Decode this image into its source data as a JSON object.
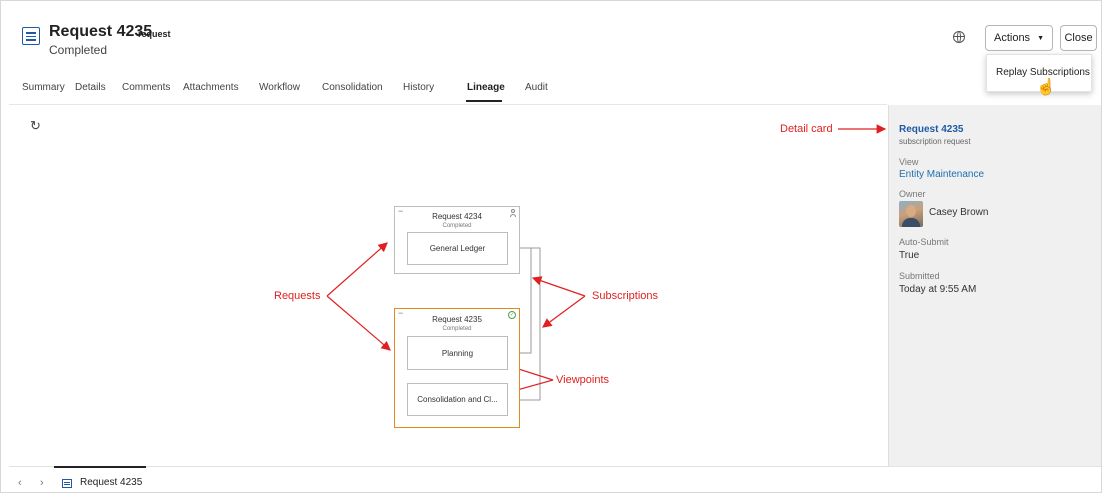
{
  "header": {
    "title": "Request 4235",
    "title_tag": "request",
    "status": "Completed",
    "icon": "request-list-icon",
    "globe_icon": "globe-icon"
  },
  "toolbar": {
    "actions_label": "Actions",
    "close_label": "Close"
  },
  "actions_menu": {
    "items": [
      "Replay Subscriptions"
    ]
  },
  "tabs": [
    "Summary",
    "Details",
    "Comments",
    "Attachments",
    "Workflow",
    "Consolidation",
    "History",
    "Lineage",
    "Audit"
  ],
  "active_tab": "Lineage",
  "diagram": {
    "refresh_icon": "refresh-icon",
    "nodes": [
      {
        "title": "Request 4234",
        "status": "Completed",
        "badge_icon": "user-icon",
        "viewpoints": [
          "General Ledger"
        ]
      },
      {
        "title": "Request 4235",
        "status": "Completed",
        "badge_icon": "check-circle-icon",
        "selected": true,
        "viewpoints": [
          "Planning",
          "Consolidation and Cl..."
        ]
      }
    ],
    "annotations": {
      "detail_card": "Detail card",
      "requests": "Requests",
      "subscriptions": "Subscriptions",
      "viewpoints": "Viewpoints"
    },
    "annotation_color": "#e02020",
    "selected_color": "#e08a1e"
  },
  "detail_card": {
    "title": "Request 4235",
    "subtitle": "subscription request",
    "view_label": "View",
    "view_value": "Entity Maintenance",
    "owner_label": "Owner",
    "owner_name": "Casey Brown",
    "auto_submit_label": "Auto-Submit",
    "auto_submit_value": "True",
    "submitted_label": "Submitted",
    "submitted_value": "Today at 9:55 AM"
  },
  "footer": {
    "prev_icon": "chevron-left-icon",
    "next_icon": "chevron-right-icon",
    "tab_label": "Request 4235"
  },
  "colors": {
    "brand_blue": "#1f5aa6",
    "link_blue": "#1f6fb0"
  }
}
